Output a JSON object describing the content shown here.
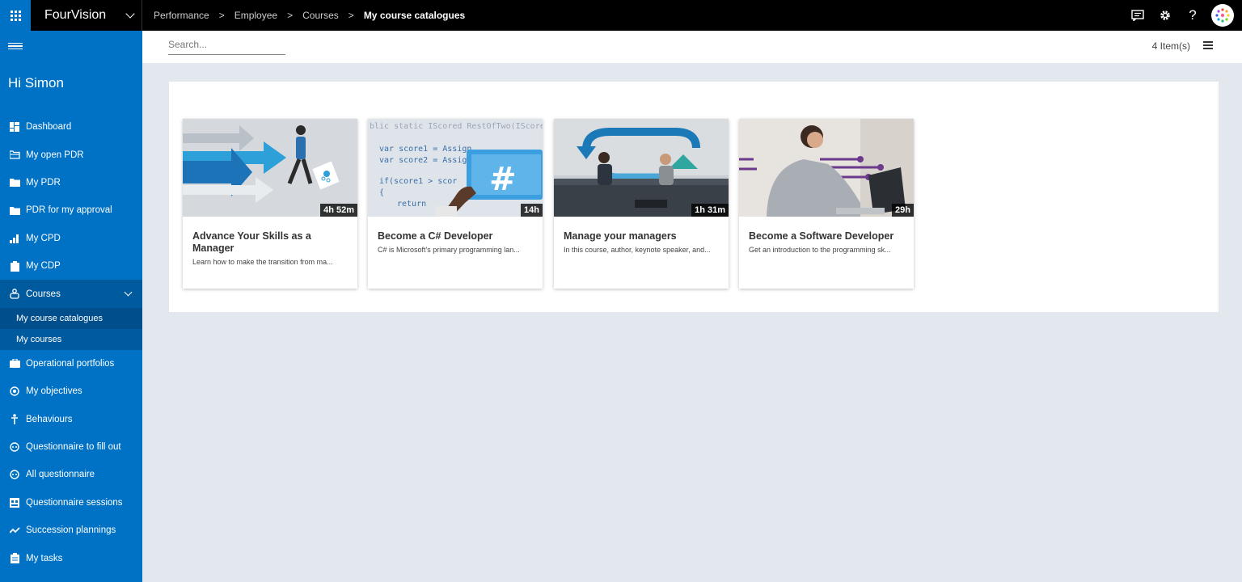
{
  "app": {
    "name": "FourVision"
  },
  "breadcrumb": [
    "Performance",
    "Employee",
    "Courses"
  ],
  "breadcrumb_current": "My course catalogues",
  "sidebar": {
    "greeting": "Hi Simon",
    "items": [
      {
        "label": "Dashboard",
        "icon": "dashboard-icon"
      },
      {
        "label": "My open PDR",
        "icon": "folder-open-icon"
      },
      {
        "label": "My PDR",
        "icon": "folder-icon"
      },
      {
        "label": "PDR for my approval",
        "icon": "folder-icon"
      },
      {
        "label": "My CPD",
        "icon": "bar-chart-icon"
      },
      {
        "label": "My CDP",
        "icon": "clipboard-icon"
      }
    ],
    "courses": {
      "label": "Courses",
      "icon": "courses-icon"
    },
    "course_sub": [
      "My course catalogues",
      "My courses"
    ],
    "items_after": [
      {
        "label": "Operational portfolios",
        "icon": "portfolio-icon"
      },
      {
        "label": "My objectives",
        "icon": "target-icon"
      },
      {
        "label": "Behaviours",
        "icon": "person-icon"
      },
      {
        "label": "Questionnaire to fill out",
        "icon": "questionnaire-icon"
      },
      {
        "label": "All questionnaire",
        "icon": "questionnaire-icon"
      },
      {
        "label": "Questionnaire sessions",
        "icon": "sessions-icon"
      },
      {
        "label": "Succession plannings",
        "icon": "trend-icon"
      },
      {
        "label": "My tasks",
        "icon": "tasks-icon"
      }
    ]
  },
  "toolbar": {
    "search_placeholder": "Search...",
    "item_count": "4 Item(s)"
  },
  "courses": [
    {
      "title": "Advance Your Skills as a Manager",
      "description": "Learn how to make the transition from ma...",
      "duration": "4h 52m"
    },
    {
      "title": "Become a C# Developer",
      "description": "C# is Microsoft's primary programming lan...",
      "duration": "14h"
    },
    {
      "title": "Manage your managers",
      "description": "In this course, author, keynote speaker, and...",
      "duration": "1h 31m"
    },
    {
      "title": "Become a Software Developer",
      "description": "Get an introduction to the programming sk...",
      "duration": "29h"
    }
  ],
  "thumb_code": {
    "line1": "blic static IScored RestOfTwo(IScored",
    "line2": "var score1 = Assign",
    "line3": "var score2 = Assign",
    "line4": "if(score1 > scor",
    "line5": "{",
    "line6": "return"
  },
  "colors": {
    "brand": "#0072c6",
    "topbar": "#000000",
    "sidebar_active": "#005a9e"
  }
}
